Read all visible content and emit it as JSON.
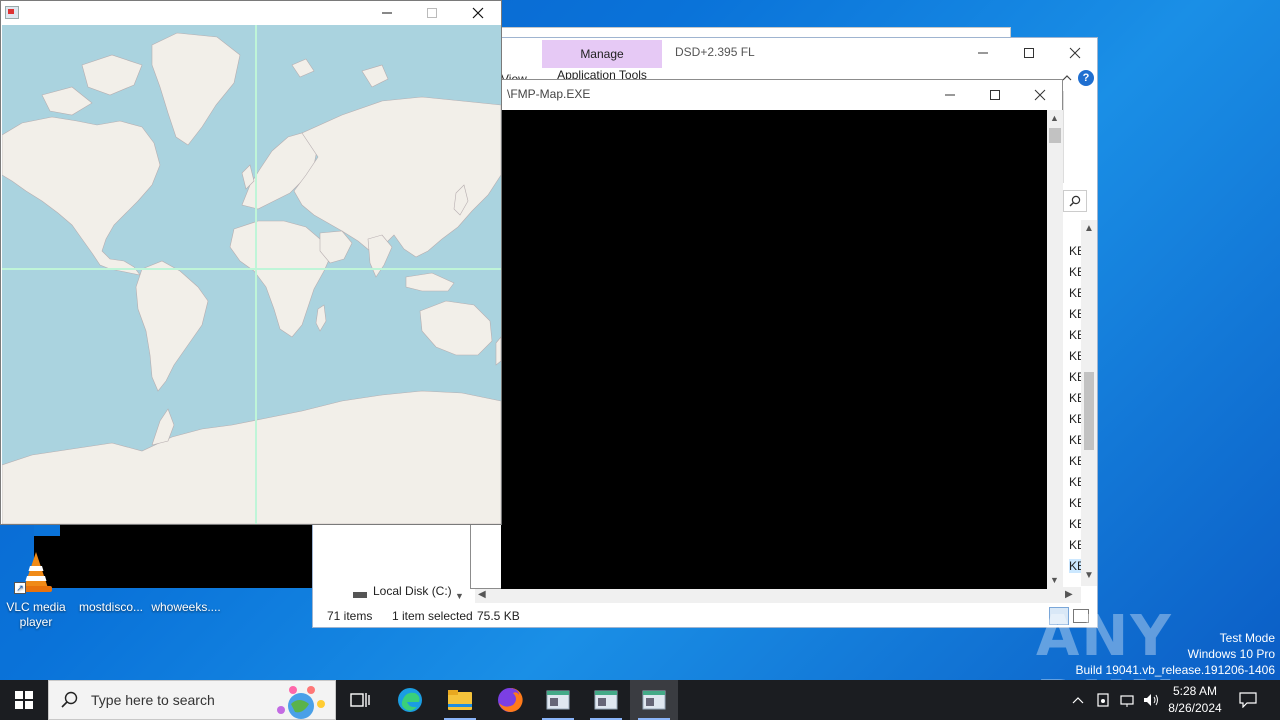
{
  "desktop": {
    "icons": [
      {
        "label_line1": "VLC media",
        "label_line2": "player"
      },
      {
        "label_line1": "mostdisco...",
        "label_line2": ""
      },
      {
        "label_line1": "whoweeks....",
        "label_line2": ""
      }
    ]
  },
  "explorer": {
    "manage_tab": "Manage",
    "application_tools": "Application Tools",
    "title": "DSD+2.395 FL",
    "view_label": "View",
    "kb_unit": "KB",
    "nav_item": "Local Disk (C:)",
    "status": {
      "items": "71 items",
      "selected": "1 item selected",
      "size": "75.5 KB"
    }
  },
  "console": {
    "title": "\\FMP-Map.EXE"
  },
  "map_window": {
    "title": ""
  },
  "taskbar": {
    "search_placeholder": "Type here to search",
    "time": "5:28 AM",
    "date": "8/26/2024"
  },
  "watermark": {
    "line1": "Test Mode",
    "line2": "Windows 10 Pro",
    "line3": "Build 19041.vb_release.191206-1406",
    "brand": "ANY RUN"
  },
  "colors": {
    "desktop_blue": "#0a73d9",
    "map_water": "#aad3df",
    "map_land": "#f2efe9",
    "manage_tab": "#e6c9f5",
    "taskbar": "#1b1d21"
  }
}
